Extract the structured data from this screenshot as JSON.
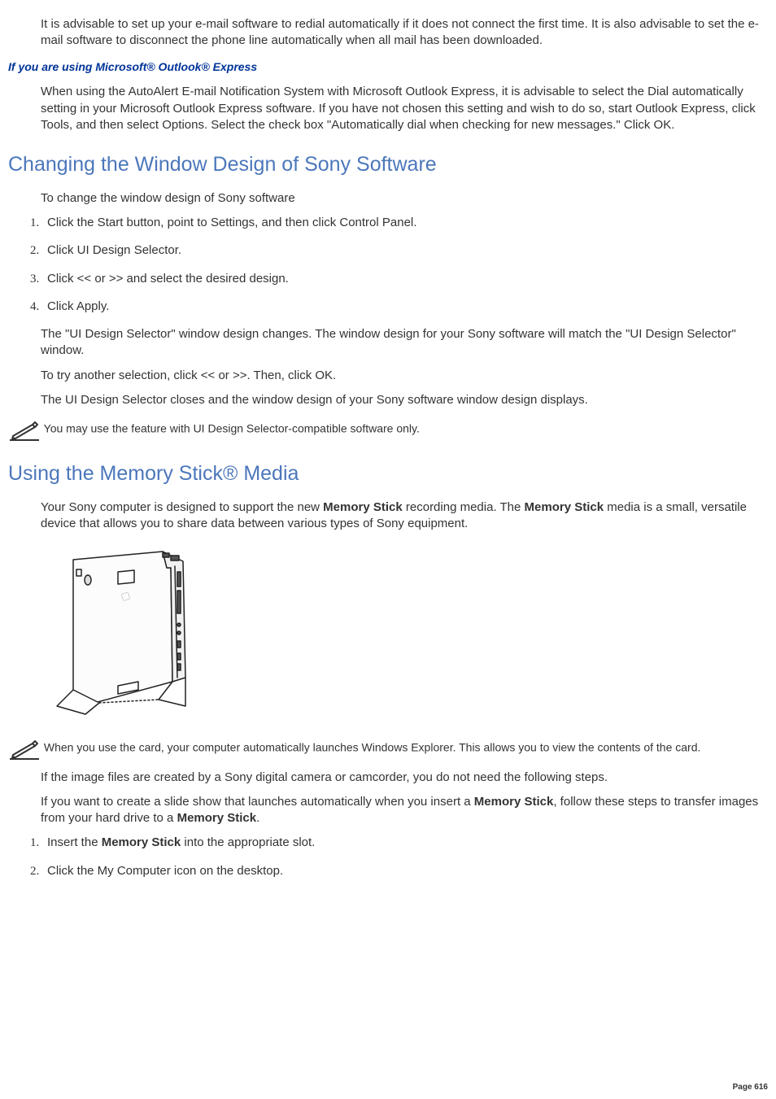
{
  "intro_para": "It is advisable to set up your e-mail software to redial automatically if it does not connect the first time. It is also advisable to set the e-mail software to disconnect the phone line automatically when all mail has been downloaded.",
  "outlook_heading": "If you are using Microsoft® Outlook® Express",
  "outlook_para": "When using the AutoAlert E-mail Notification System with Microsoft Outlook Express, it is advisable to select the Dial automatically setting in your Microsoft Outlook Express software. If you have not chosen this setting and wish to do so, start Outlook Express, click Tools, and then select Options. Select the check box \"Automatically dial when checking for new messages.\" Click OK.",
  "h2_changing": "Changing the Window Design of Sony Software",
  "changing_intro": "To change the window design of Sony software",
  "changing_steps": {
    "s1": "Click the Start button, point to Settings, and then click Control Panel.",
    "s2": "Click UI Design Selector.",
    "s3": "Click << or >> and select the desired design.",
    "s4": "Click Apply."
  },
  "changing_p1": "The \"UI Design Selector\" window design changes. The window design for your Sony software will match the \"UI Design Selector\" window.",
  "changing_p2": "To try another selection, click << or >>. Then, click OK.",
  "changing_p3": "The UI Design Selector closes and the window design of your Sony software window design displays.",
  "changing_note": " You may use the feature with UI Design Selector-compatible software only.",
  "h2_memstick": "Using the Memory Stick® Media",
  "mem_intro_1": "Your Sony computer is designed to support the new ",
  "mem_intro_bold1": "Memory Stick",
  "mem_intro_2": " recording media. The ",
  "mem_intro_bold2": "Memory Stick",
  "mem_intro_3": " media is a small, versatile device that allows you to share data between various types of Sony equipment.",
  "mem_note": " When you use the card, your computer automatically launches Windows Explorer. This allows you to view the contents of the card.",
  "mem_p1": "If the image files are created by a Sony digital camera or camcorder, you do not need the following steps.",
  "mem_p2_1": "If you want to create a slide show that launches automatically when you insert a ",
  "mem_p2_b1": "Memory Stick",
  "mem_p2_2": ", follow these steps to transfer images from your hard drive to a ",
  "mem_p2_b2": "Memory Stick",
  "mem_p2_3": ".",
  "mem_steps": {
    "s1_1": "Insert the ",
    "s1_b": "Memory Stick",
    "s1_2": " into the appropriate slot.",
    "s2": "Click the My Computer icon on the desktop."
  },
  "page_number": "Page 616"
}
